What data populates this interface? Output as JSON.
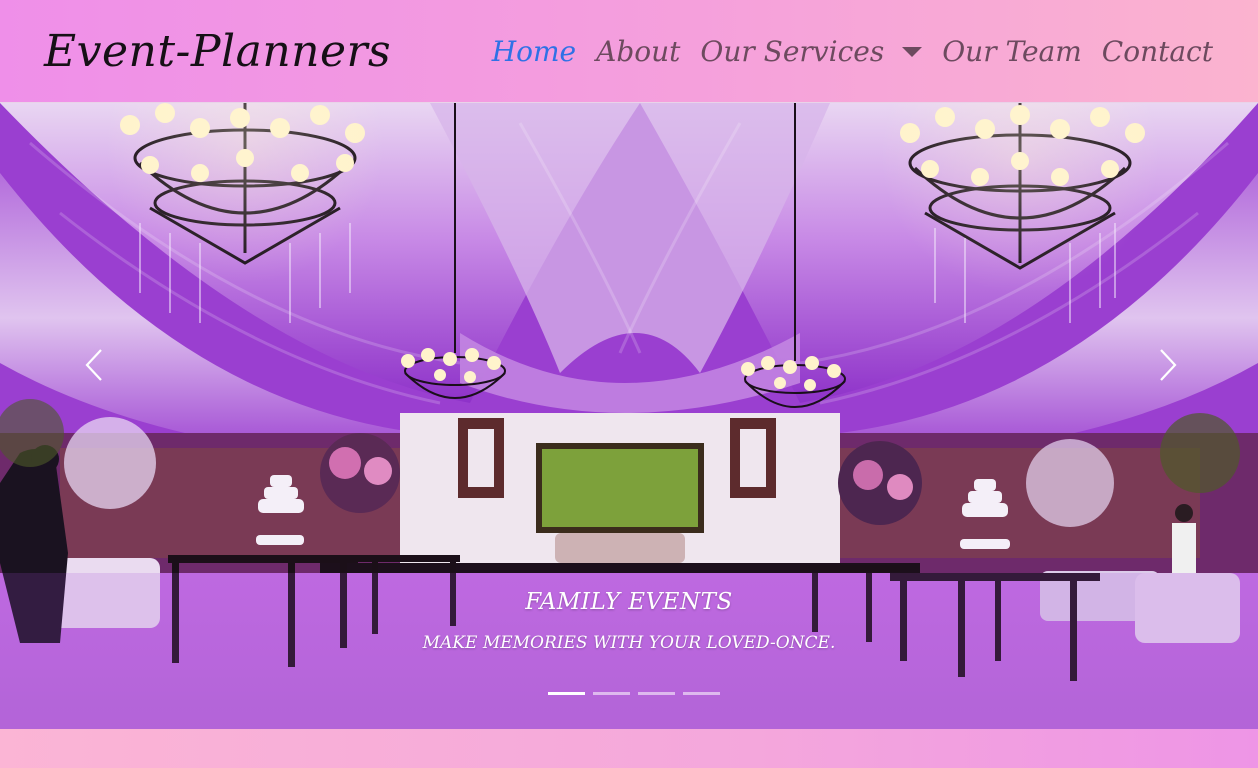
{
  "brand": "Event-Planners",
  "nav": {
    "home": "Home",
    "about": "About",
    "services": "Our Services",
    "team": "Our Team",
    "contact": "Contact"
  },
  "carousel": {
    "title": "FAMILY EVENTS",
    "subtitle": "MAKE MEMORIES WITH YOUR LOVED-ONCE.",
    "active_slide": 1,
    "slide_count": 4,
    "prev_icon": "chevron-left-icon",
    "next_icon": "chevron-right-icon"
  },
  "colors": {
    "nav_bg": "#f5a0dc",
    "nav_active": "#2f71e6",
    "nav_text": "#6d4a5f",
    "brand_text": "#161016",
    "hero_purple": "#a44fd6"
  }
}
